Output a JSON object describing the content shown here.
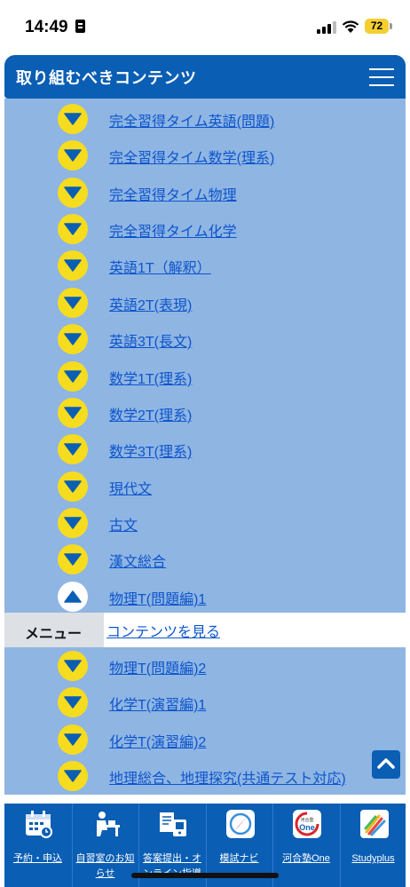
{
  "status_bar": {
    "time": "14:49",
    "battery": "72"
  },
  "header": {
    "title": "取り組むべきコンテンツ"
  },
  "content_items": [
    {
      "label": "完全習得タイム英語(問題)",
      "state": "collapsed"
    },
    {
      "label": "完全習得タイム数学(理系)",
      "state": "collapsed"
    },
    {
      "label": "完全習得タイム物理",
      "state": "collapsed"
    },
    {
      "label": "完全習得タイム化学",
      "state": "collapsed"
    },
    {
      "label": "英語1T（解釈）",
      "state": "collapsed"
    },
    {
      "label": "英語2T(表現)",
      "state": "collapsed"
    },
    {
      "label": "英語3T(長文)",
      "state": "collapsed"
    },
    {
      "label": "数学1T(理系)",
      "state": "collapsed"
    },
    {
      "label": "数学2T(理系)",
      "state": "collapsed"
    },
    {
      "label": "数学3T(理系)",
      "state": "collapsed"
    },
    {
      "label": "現代文",
      "state": "collapsed"
    },
    {
      "label": "古文",
      "state": "collapsed"
    },
    {
      "label": "漢文総合",
      "state": "collapsed"
    },
    {
      "label": "物理T(問題編)1",
      "state": "expanded"
    },
    {
      "label": "物理T(問題編)2",
      "state": "collapsed"
    },
    {
      "label": "化学T(演習編)1",
      "state": "collapsed"
    },
    {
      "label": "化学T(演習編)2",
      "state": "collapsed"
    },
    {
      "label": "地理総合、地理探究(共通テスト対応)",
      "state": "collapsed"
    }
  ],
  "expanded_menu": {
    "label": "メニュー",
    "link": "コンテンツを見る"
  },
  "tabbar": [
    {
      "label": "予約・申込",
      "icon": "calendar-icon"
    },
    {
      "label": "自習室のお知らせ",
      "icon": "study-desk-icon"
    },
    {
      "label": "答案提出・オンライン指導",
      "icon": "answer-submit-icon"
    },
    {
      "label": "模試ナビ",
      "icon": "compass-icon"
    },
    {
      "label": "河合塾One",
      "icon": "kawaijuku-one-icon"
    },
    {
      "label": "Studyplus",
      "icon": "studyplus-icon"
    }
  ],
  "colors": {
    "brand_blue": "#0a5eb3",
    "list_background": "#8fb5e3",
    "toggle_yellow": "#f6dc1f",
    "link_blue": "#0d55cc"
  }
}
